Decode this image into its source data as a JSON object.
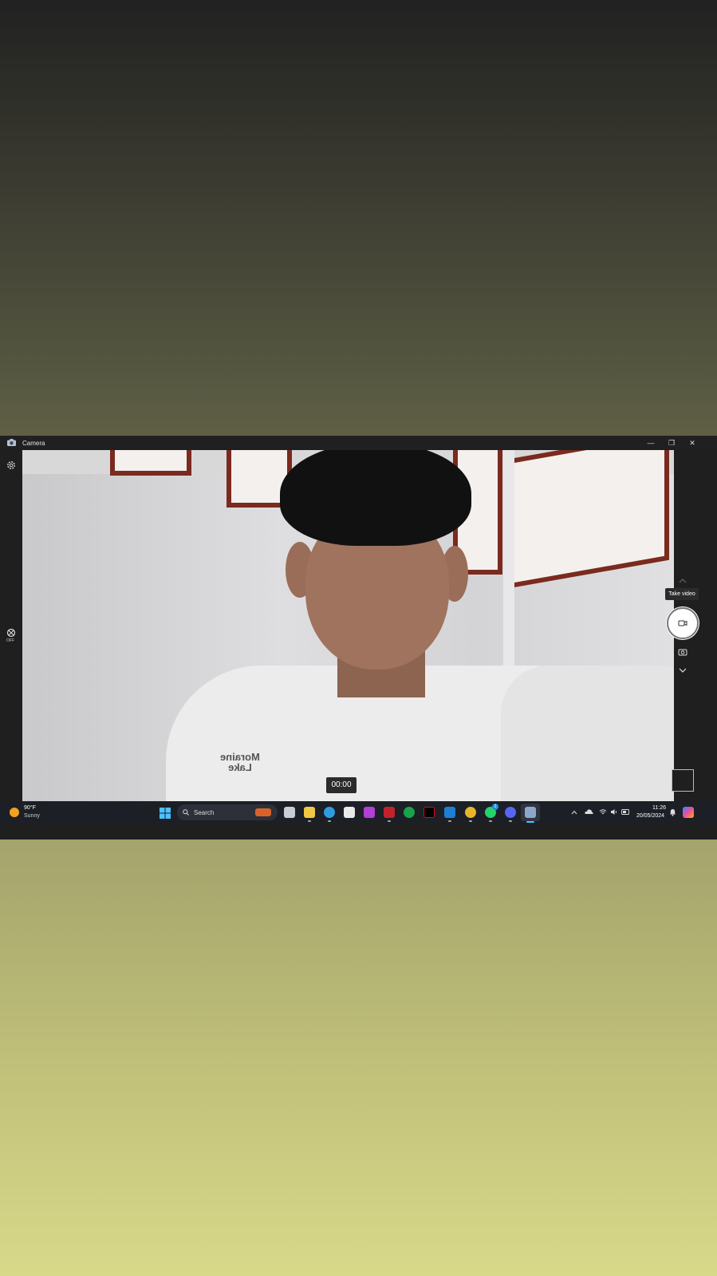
{
  "window": {
    "title": "Camera",
    "minimize": "—",
    "restore": "❐",
    "close": "✕"
  },
  "left_toolbar": {
    "settings_icon": "gear-icon",
    "hdr_icon": "hdr-icon",
    "hdr_label": "OFF"
  },
  "viewfinder": {
    "timer": "00:00",
    "shirt_print": [
      "Moraine",
      "Lake"
    ]
  },
  "right_controls": {
    "tooltip": "Take video",
    "mode_up_icon": "chevron-up-icon",
    "mode_down_icon": "chevron-down-icon",
    "photo_mode_icon": "camera-icon",
    "shutter_icon": "video-camera-icon"
  },
  "taskbar": {
    "weather": {
      "temp": "90°F",
      "condition": "Sunny"
    },
    "search_placeholder": "Search",
    "badges": {
      "whatsapp": "2"
    },
    "clock": {
      "time": "11:26",
      "date": "20/05/2024"
    }
  }
}
